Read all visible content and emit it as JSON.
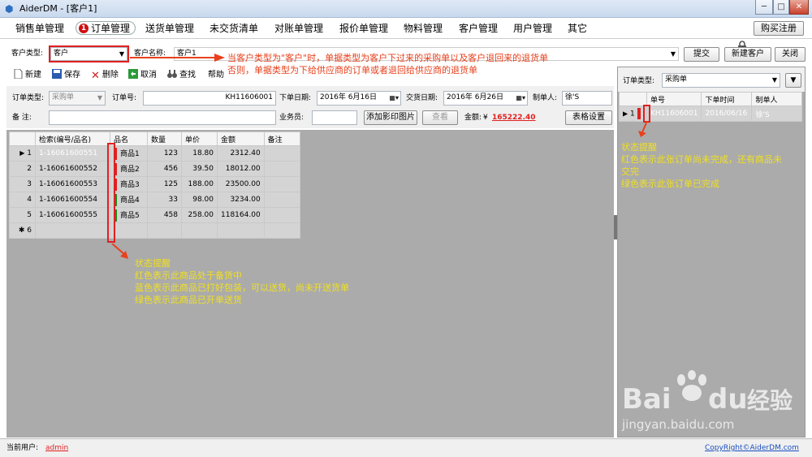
{
  "window": {
    "title": "AiderDM - [客户1]",
    "buttons": [
      "─",
      "□",
      "✕"
    ]
  },
  "menu": {
    "items": [
      "销售单管理",
      "订单管理",
      "送货单管理",
      "未交货清单",
      "对账单管理",
      "报价单管理",
      "物料管理",
      "客户管理",
      "用户管理",
      "其它"
    ],
    "active_badge": "1",
    "register": "购买注册"
  },
  "customer_bar": {
    "type_label": "客户类型:",
    "type_value": "客户",
    "name_label": "客户名称:",
    "name_value": "客户1",
    "submit": "提交",
    "new_customer": "新建客户",
    "close": "关闭"
  },
  "annotations": {
    "top_line1": "当客户类型为\"客户\"时，单据类型为客户下过来的采购单以及客户退回来的退货单",
    "top_line2": "否则，单据类型为下给供应商的订单或者退回给供应商的退货单",
    "item_status": [
      "状态提醒",
      "红色表示此商品处于备货中",
      "蓝色表示此商品已打好包装，可以送货，尚未开送货单",
      "绿色表示此商品已开单送货"
    ],
    "order_status": [
      "状态提醒",
      "红色表示此张订单尚未完成，还有商品未",
      "交完",
      "绿色表示此张订单已完成"
    ]
  },
  "toolbar": {
    "new": "新建",
    "save": "保存",
    "delete": "删除",
    "cancel": "取消",
    "find": "查找",
    "help": "帮助"
  },
  "form": {
    "order_type_label": "订单类型:",
    "order_type_value": "采购单",
    "order_no_label": "订单号:",
    "order_no_value": "KH11606001",
    "order_date_label": "下单日期:",
    "order_date_value": "2016年  6月16日",
    "delivery_date_label": "交货日期:",
    "delivery_date_value": "2016年  6月26日",
    "maker_label": "制单人:",
    "maker_value": "徐'S",
    "remark_label": "备    注:",
    "salesman_label": "业务员:",
    "add_image": "添加影印图片",
    "view": "查看",
    "amount_label": "金额:",
    "amount_currency": "¥",
    "amount_value": "165222.40",
    "table_settings": "表格设置"
  },
  "grid": {
    "columns": [
      "检索(编号/品名)",
      "品名",
      "数量",
      "单价",
      "金额",
      "备注"
    ],
    "rows": [
      {
        "no": "1",
        "code": "1-16061600551",
        "name": "商品1",
        "qty": "123",
        "price": "18.80",
        "amount": "2312.40",
        "status": "#e02020"
      },
      {
        "no": "2",
        "code": "1-16061600552",
        "name": "商品2",
        "qty": "456",
        "price": "39.50",
        "amount": "18012.00",
        "status": "#e02020"
      },
      {
        "no": "3",
        "code": "1-16061600553",
        "name": "商品3",
        "qty": "125",
        "price": "188.00",
        "amount": "23500.00",
        "status": "#e02020"
      },
      {
        "no": "4",
        "code": "1-16061600554",
        "name": "商品4",
        "qty": "33",
        "price": "98.00",
        "amount": "3234.00",
        "status": "#1a8a1a"
      },
      {
        "no": "5",
        "code": "1-16061600555",
        "name": "商品5",
        "qty": "458",
        "price": "258.00",
        "amount": "118164.00",
        "status": "#1a8a1a"
      }
    ],
    "new_row_no": "6"
  },
  "right_panel": {
    "type_label": "订单类型:",
    "type_value": "采购单",
    "columns": [
      "单号",
      "下单时间",
      "制单人"
    ],
    "rows": [
      {
        "no": "1",
        "order": "KH11606001",
        "date": "2016/06/16",
        "maker": "徐'S",
        "status": "#e02020"
      }
    ]
  },
  "status_bar": {
    "user_label": "当前用户:",
    "user": "admin",
    "copyright": "CopyRight©AiderDM.com"
  },
  "watermark": {
    "brand": "Bai",
    "brand2": "du",
    "cn": "经验",
    "url": "jingyan.baidu.com"
  }
}
